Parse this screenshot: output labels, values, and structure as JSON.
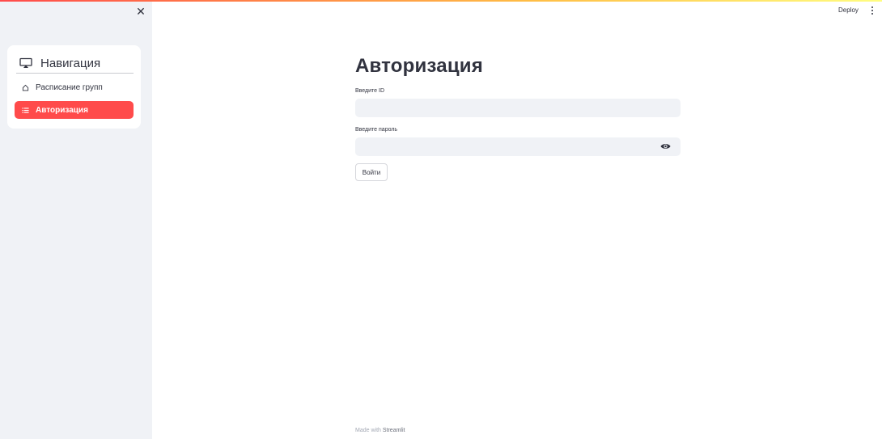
{
  "app": {
    "accent_color": "#ff4b4b",
    "deploy_label": "Deploy"
  },
  "sidebar": {
    "close_icon": "close-icon",
    "nav_title": "Навигация",
    "nav_icon": "monitor-icon",
    "items": [
      {
        "label": "Расписание групп",
        "icon": "house-icon",
        "active": false
      },
      {
        "label": "Авторизация",
        "icon": "list-icon",
        "active": true
      }
    ]
  },
  "main": {
    "title": "Авторизация",
    "id_field": {
      "label": "Введите ID",
      "value": "",
      "placeholder": ""
    },
    "password_field": {
      "label": "Введите пароль",
      "value": "",
      "placeholder": ""
    },
    "submit_label": "Войти"
  },
  "footer": {
    "prefix": "Made with ",
    "brand": "Streamlit"
  }
}
